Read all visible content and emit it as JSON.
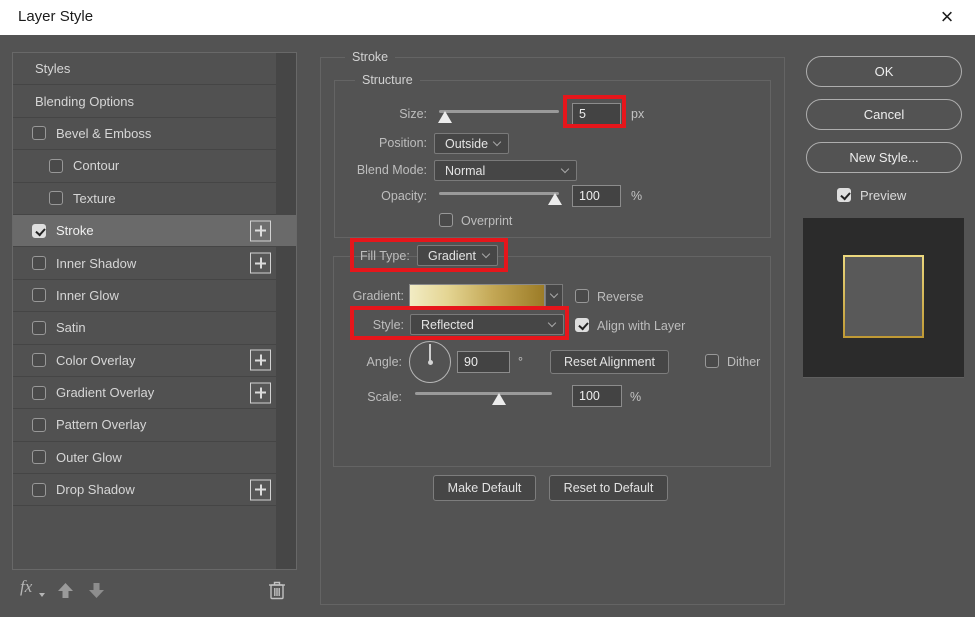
{
  "window": {
    "title": "Layer Style",
    "close_glyph": "×"
  },
  "colors": {
    "dialog_bg": "#535353",
    "annotation_red": "#e6161b",
    "sidebar_selected_bg": "#6a6a6a",
    "gradient_swatch_start": "#f2ecc4",
    "gradient_swatch_end": "#9c7c27",
    "preview_stroke_gold": "#d9ba4f",
    "preview_bg": "#2b2b2b"
  },
  "sidebar": {
    "items": [
      {
        "label": "Styles",
        "checkbox": false
      },
      {
        "label": "Blending Options",
        "checkbox": false
      },
      {
        "label": "Bevel & Emboss",
        "checkbox": true,
        "checked": false
      },
      {
        "label": "Contour",
        "checkbox": true,
        "checked": false,
        "indented": true
      },
      {
        "label": "Texture",
        "checkbox": true,
        "checked": false,
        "indented": true
      },
      {
        "label": "Stroke",
        "checkbox": true,
        "checked": true,
        "selected": true,
        "plus_button": true
      },
      {
        "label": "Inner Shadow",
        "checkbox": true,
        "checked": false,
        "plus_button": true
      },
      {
        "label": "Inner Glow",
        "checkbox": true,
        "checked": false
      },
      {
        "label": "Satin",
        "checkbox": true,
        "checked": false
      },
      {
        "label": "Color Overlay",
        "checkbox": true,
        "checked": false,
        "plus_button": true
      },
      {
        "label": "Gradient Overlay",
        "checkbox": true,
        "checked": false,
        "plus_button": true
      },
      {
        "label": "Pattern Overlay",
        "checkbox": true,
        "checked": false
      },
      {
        "label": "Outer Glow",
        "checkbox": true,
        "checked": false
      },
      {
        "label": "Drop Shadow",
        "checkbox": true,
        "checked": false,
        "plus_button": true
      }
    ],
    "fx_label": "fx"
  },
  "stroke_panel": {
    "title": "Stroke",
    "structure": {
      "title": "Structure",
      "size_label": "Size:",
      "size_value": "5",
      "size_unit": "px",
      "size_slider_percent": 5,
      "position_label": "Position:",
      "position_value": "Outside",
      "blend_mode_label": "Blend Mode:",
      "blend_mode_value": "Normal",
      "opacity_label": "Opacity:",
      "opacity_value": "100",
      "opacity_unit": "%",
      "opacity_slider_percent": 97,
      "overprint_label": "Overprint",
      "overprint_checked": false
    },
    "fill": {
      "fill_type_label": "Fill Type:",
      "fill_type_value": "Gradient",
      "gradient_label": "Gradient:",
      "reverse_label": "Reverse",
      "reverse_checked": false,
      "style_label": "Style:",
      "style_value": "Reflected",
      "align_label": "Align with Layer",
      "align_checked": true,
      "angle_label": "Angle:",
      "angle_value": "90",
      "angle_unit": "°",
      "reset_alignment_label": "Reset Alignment",
      "dither_label": "Dither",
      "dither_checked": false,
      "scale_label": "Scale:",
      "scale_value": "100",
      "scale_unit": "%",
      "scale_slider_percent": 61
    },
    "make_default_label": "Make Default",
    "reset_default_label": "Reset to Default"
  },
  "actions": {
    "ok": "OK",
    "cancel": "Cancel",
    "new_style": "New Style...",
    "preview_label": "Preview",
    "preview_checked": true
  }
}
